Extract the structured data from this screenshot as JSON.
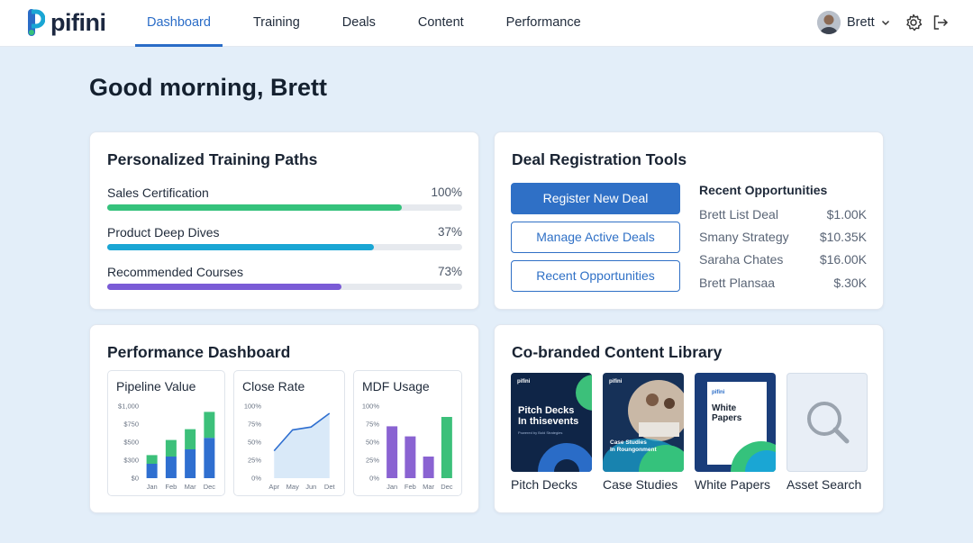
{
  "app": {
    "logo_text": "pifini"
  },
  "nav": {
    "items": [
      {
        "label": "Dashboard",
        "active": true
      },
      {
        "label": "Training",
        "active": false
      },
      {
        "label": "Deals",
        "active": false
      },
      {
        "label": "Content",
        "active": false
      },
      {
        "label": "Performance",
        "active": false
      }
    ]
  },
  "user": {
    "name": "Brett"
  },
  "greeting": "Good morning, Brett",
  "training": {
    "title": "Personalized Training Paths",
    "paths": [
      {
        "label": "Sales Certification",
        "pct_label": "100%",
        "fill": 0.83,
        "color": "#35c27c"
      },
      {
        "label": "Product Deep Dives",
        "pct_label": "37%",
        "fill": 0.75,
        "color": "#1aa6d4"
      },
      {
        "label": "Recommended Courses",
        "pct_label": "73%",
        "fill": 0.66,
        "color": "#7a5bd6"
      }
    ]
  },
  "deals": {
    "title": "Deal Registration Tools",
    "buttons": {
      "register": "Register New Deal",
      "manage": "Manage Active Deals",
      "recent": "Recent Opportunities"
    },
    "recent_title": "Recent Opportunities",
    "opportunities": [
      {
        "name": "Brett List Deal",
        "amount": "$1.00K"
      },
      {
        "name": "Smany Strategy",
        "amount": "$10.35K"
      },
      {
        "name": "Saraha Chates",
        "amount": "$16.00K"
      },
      {
        "name": "Brett Plansaa",
        "amount": "$.30K"
      }
    ]
  },
  "performance": {
    "title": "Performance Dashboard",
    "pipeline": {
      "title": "Pipeline Value",
      "y_ticks": [
        "$1,000",
        "$750",
        "$500",
        "$300",
        "$0"
      ],
      "categories": [
        "Jan",
        "Feb",
        "Mar",
        "Dec"
      ],
      "blue": [
        200,
        300,
        400,
        560
      ],
      "green": [
        120,
        230,
        280,
        360
      ],
      "ymax": 1000
    },
    "close_rate": {
      "title": "Close Rate",
      "y_ticks": [
        "100%",
        "75%",
        "50%",
        "25%",
        "0%"
      ],
      "categories": [
        "Apr",
        "May",
        "Jun",
        "Det"
      ],
      "values": [
        38,
        67,
        71,
        90
      ]
    },
    "mdf": {
      "title": "MDF Usage",
      "y_ticks": [
        "100%",
        "75%",
        "50%",
        "25%",
        "0%"
      ],
      "categories": [
        "Jan",
        "Feb",
        "Mar",
        "Dec"
      ],
      "values": [
        72,
        58,
        30,
        85
      ],
      "colors": [
        "#8a63d2",
        "#8a63d2",
        "#8a63d2",
        "#3cc07a"
      ]
    }
  },
  "content": {
    "title": "Co-branded Content Library",
    "tiles": [
      {
        "caption": "Pitch Decks",
        "brand": "pifini",
        "text": "Pitch Decks\nIn thisevents",
        "sub": "Powered by Bold Strategies"
      },
      {
        "caption": "Case Studies",
        "brand": "pifini",
        "text": "Case Studies\nIn Roungonment"
      },
      {
        "caption": "White Papers",
        "brand": "pifini",
        "text": "White\nPapers"
      },
      {
        "caption": "Asset Search"
      }
    ]
  },
  "colors": {
    "accent": "#2f70c6",
    "nav_active": "#2a6cc7"
  }
}
